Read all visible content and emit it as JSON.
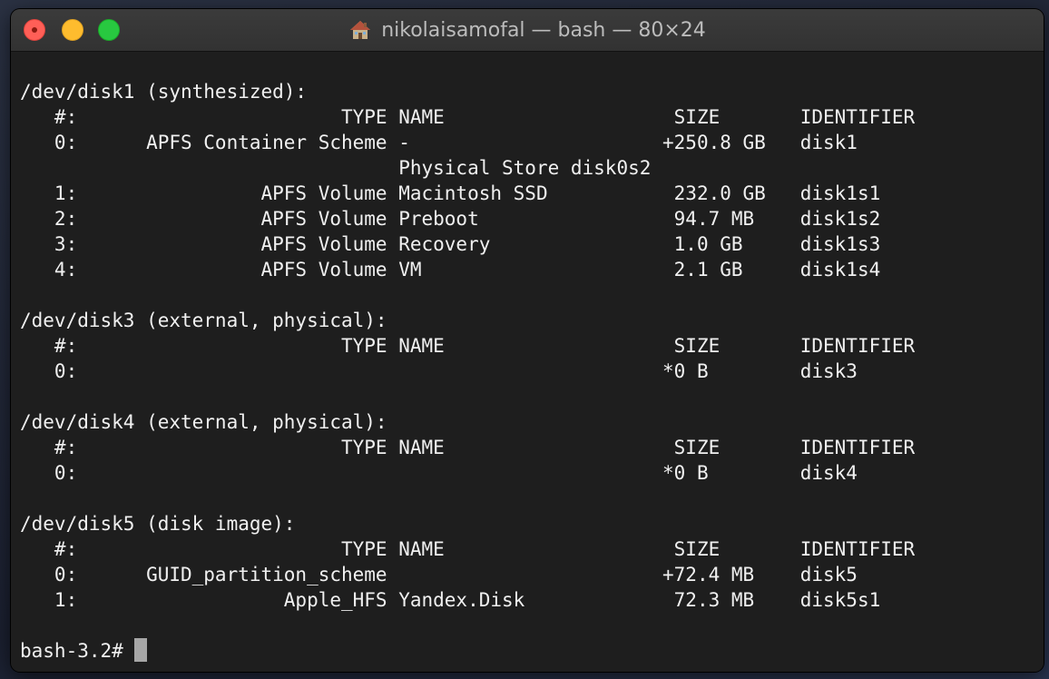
{
  "window": {
    "title": "nikolaisamofal — bash — 80×24",
    "title_icon": "home-icon"
  },
  "colors": {
    "close": "#ff5f57",
    "minimize": "#febc2e",
    "maximize": "#28c840",
    "terminal_bg": "#1e1e1e",
    "terminal_fg": "#f0f0f0"
  },
  "terminal": {
    "lines": [
      "/dev/disk1 (synthesized):",
      "   #:                       TYPE NAME                    SIZE       IDENTIFIER",
      "   0:      APFS Container Scheme -                      +250.8 GB   disk1",
      "                                 Physical Store disk0s2",
      "   1:                APFS Volume Macintosh SSD           232.0 GB   disk1s1",
      "   2:                APFS Volume Preboot                 94.7 MB    disk1s2",
      "   3:                APFS Volume Recovery                1.0 GB     disk1s3",
      "   4:                APFS Volume VM                      2.1 GB     disk1s4",
      "",
      "/dev/disk3 (external, physical):",
      "   #:                       TYPE NAME                    SIZE       IDENTIFIER",
      "   0:                                                   *0 B        disk3",
      "",
      "/dev/disk4 (external, physical):",
      "   #:                       TYPE NAME                    SIZE       IDENTIFIER",
      "   0:                                                   *0 B        disk4",
      "",
      "/dev/disk5 (disk image):",
      "   #:                       TYPE NAME                    SIZE       IDENTIFIER",
      "   0:      GUID_partition_scheme                        +72.4 MB    disk5",
      "   1:                  Apple_HFS Yandex.Disk             72.3 MB    disk5s1",
      ""
    ],
    "prompt": "bash-3.2# "
  }
}
